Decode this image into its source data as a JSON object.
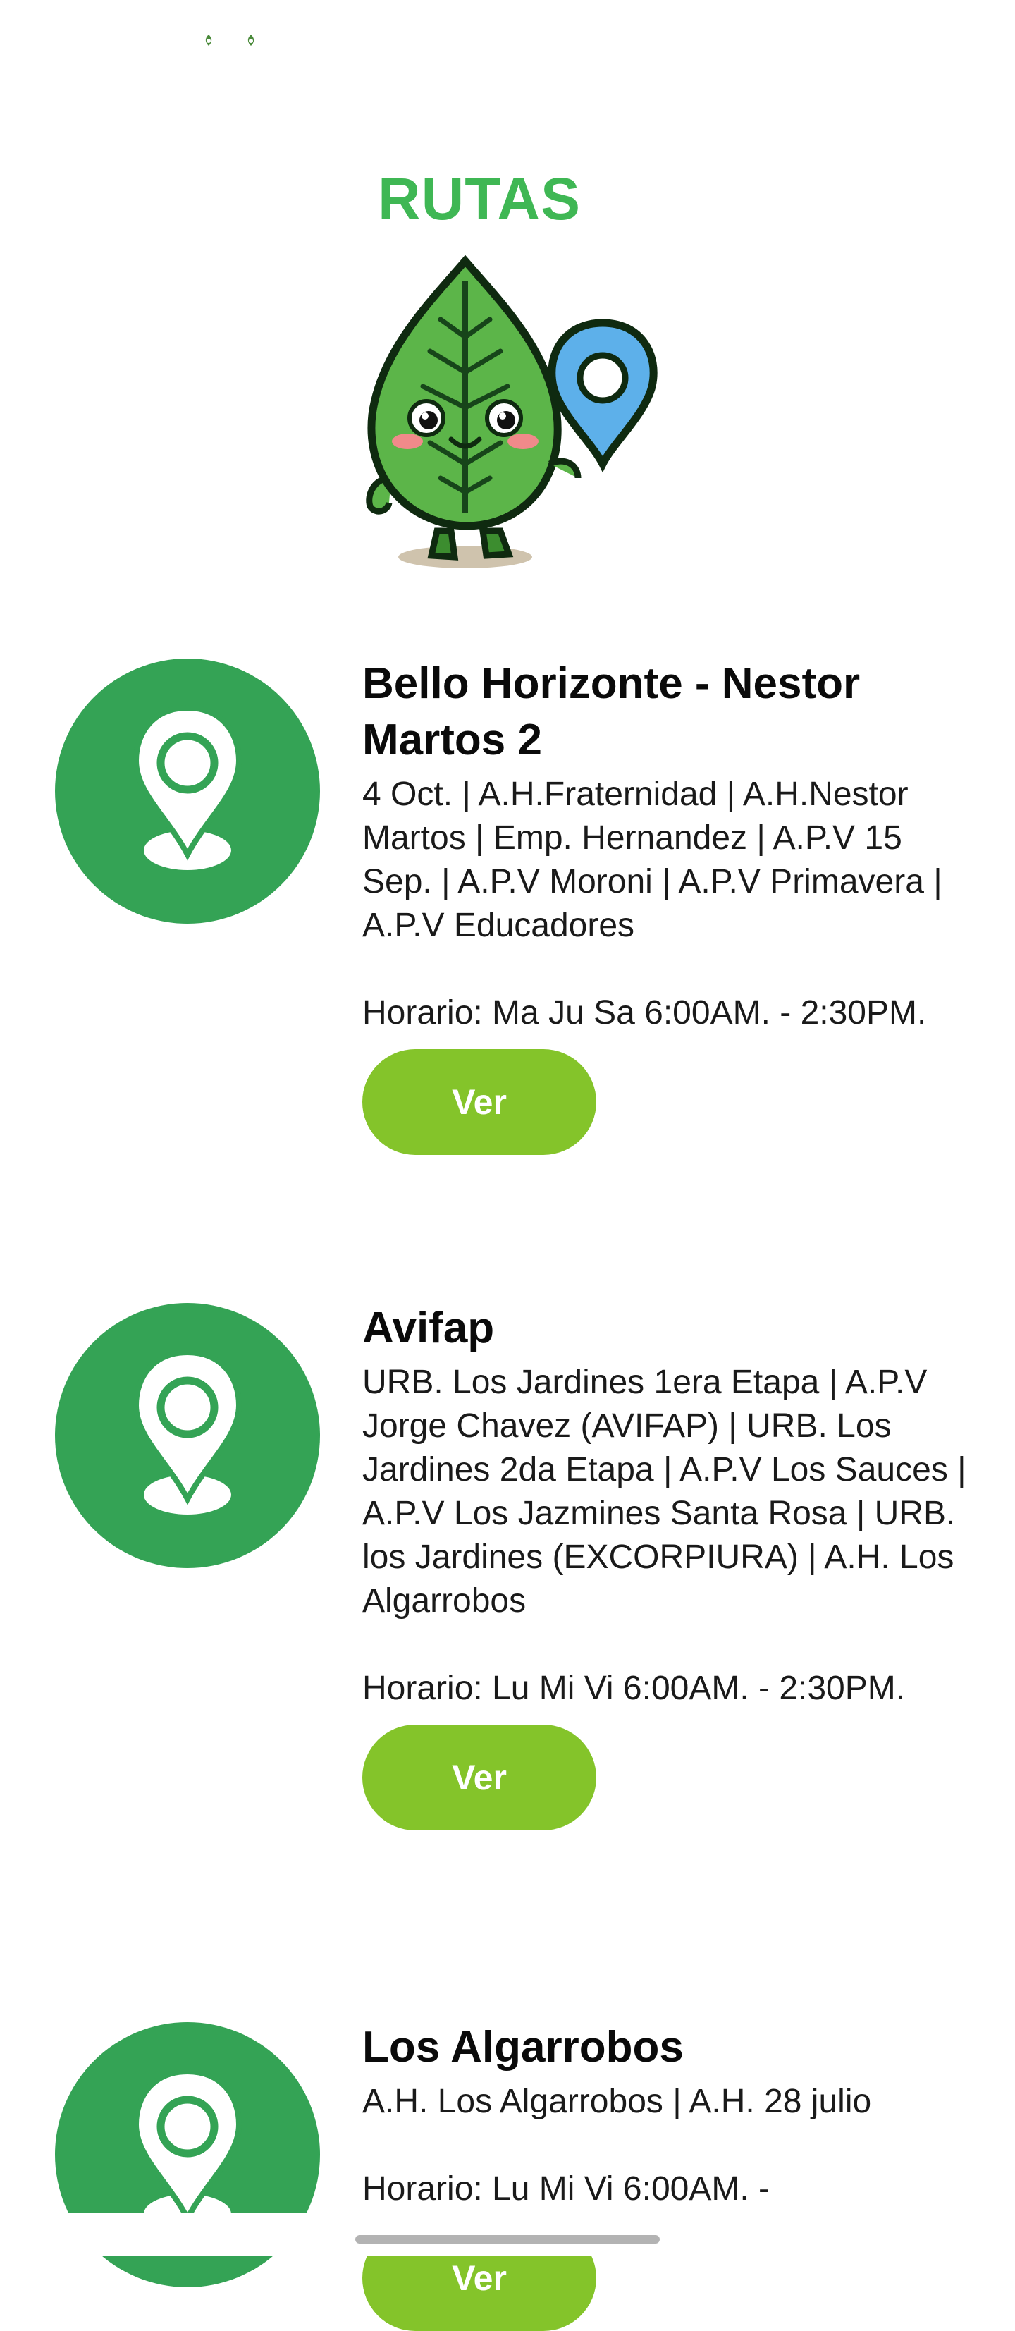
{
  "header": {
    "title": "RUTAS",
    "status_icons": [
      "leaf-logo-icon",
      "leaf-logo-icon"
    ]
  },
  "colors": {
    "title_green": "#3fb754",
    "icon_circle": "#34a355",
    "button_green": "#84c42a"
  },
  "routes": [
    {
      "title": "Bello Horizonte - Nestor Martos 2",
      "description": "4 Oct. | A.H.Fraternidad | A.H.Nestor Martos | Emp. Hernandez | A.P.V 15 Sep. | A.P.V Moroni | A.P.V Primavera | A.P.V Educadores",
      "schedule": " Horario: Ma Ju Sa  6:00AM. - 2:30PM.",
      "button_label": "Ver",
      "icon": "map-pin-icon"
    },
    {
      "title": "Avifap",
      "description": "URB. Los Jardines 1era Etapa | A.P.V Jorge Chavez (AVIFAP) | URB. Los Jardines 2da Etapa | A.P.V Los Sauces | A.P.V Los Jazmines Santa Rosa | URB. los Jardines (EXCORPIURA) | A.H. Los Algarrobos",
      "schedule": " Horario: Lu Mi Vi  6:00AM. - 2:30PM.",
      "button_label": "Ver",
      "icon": "map-pin-icon"
    },
    {
      "title": "Los Algarrobos",
      "description": "A.H. Los Algarrobos | A.H. 28 julio",
      "schedule": " Horario: Lu Mi Vi  6:00AM. -",
      "button_label": "Ver",
      "icon": "map-pin-icon"
    }
  ]
}
